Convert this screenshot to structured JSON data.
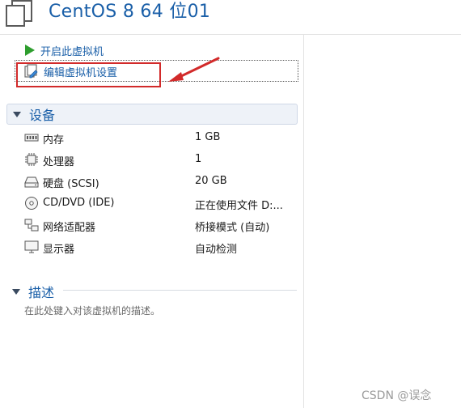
{
  "vm": {
    "title": "CentOS 8 64 位01",
    "icon": "vm-window-icon"
  },
  "actions": {
    "power_on": {
      "label": "开启此虚拟机",
      "icon": "play-icon"
    },
    "edit_settings": {
      "label": "编辑虚拟机设置",
      "icon": "edit-settings-icon"
    }
  },
  "devices": {
    "header": "设备",
    "items": [
      {
        "name": "内存",
        "value": "1 GB",
        "icon": "memory-icon"
      },
      {
        "name": "处理器",
        "value": "1",
        "icon": "processor-icon"
      },
      {
        "name": "硬盘 (SCSI)",
        "value": "20 GB",
        "icon": "harddisk-icon"
      },
      {
        "name": "CD/DVD (IDE)",
        "value": "正在使用文件 D:...",
        "icon": "cd-dvd-icon"
      },
      {
        "name": "网络适配器",
        "value": "桥接模式 (自动)",
        "icon": "network-adapter-icon"
      },
      {
        "name": "显示器",
        "value": "自动检测",
        "icon": "display-icon"
      }
    ]
  },
  "description": {
    "header": "描述",
    "placeholder": "在此处键入对该虚拟机的描述。"
  },
  "watermark": "CSDN @误念",
  "colors": {
    "link_blue": "#1a5fa8",
    "highlight_red": "#d22a2a",
    "play_green": "#2e9e2e"
  }
}
